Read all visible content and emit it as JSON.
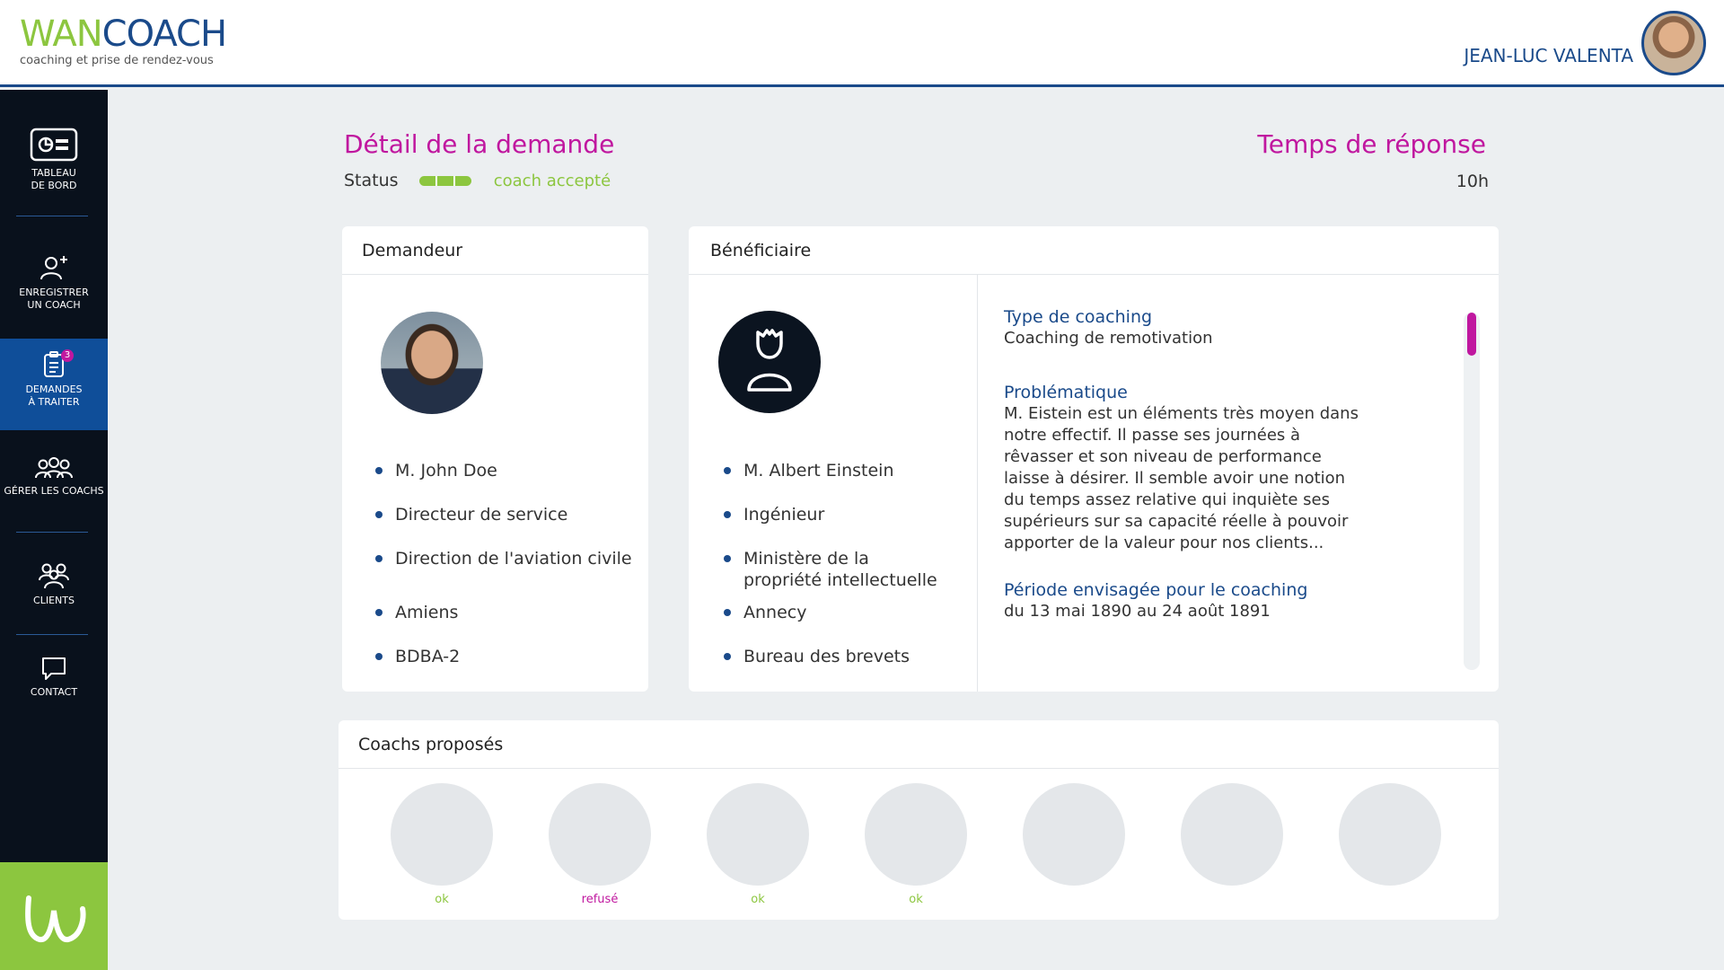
{
  "header": {
    "logo_main_a": "WAN",
    "logo_main_b": "COACH",
    "logo_sub": "coaching et prise de rendez-vous",
    "user_name": "JEAN-LUC VALENTA"
  },
  "sidebar": {
    "items": [
      {
        "label_1": "TABLEAU",
        "label_2": "DE BORD",
        "icon": "dashboard-icon"
      },
      {
        "label_1": "ENREGISTRER",
        "label_2": "UN COACH",
        "icon": "add-user-icon"
      },
      {
        "label_1": "DEMANDES",
        "label_2": "À TRAITER",
        "icon": "requests-icon",
        "badge": "3"
      },
      {
        "label_1": "GÉRER LES COACHS",
        "icon": "manage-coaches-icon"
      },
      {
        "label_1": "CLIENTS",
        "icon": "clients-icon"
      },
      {
        "label_1": "CONTACT",
        "icon": "chat-icon"
      }
    ],
    "brand_icon": "wancoach-w-logo"
  },
  "main": {
    "title": "Détail de la demande",
    "status_label": "Status",
    "status_text": "coach accepté",
    "response_title": "Temps de réponse",
    "response_time": "10h"
  },
  "requester": {
    "header": "Demandeur",
    "items": [
      "M. John Doe",
      "Directeur de service",
      "Direction de l'aviation civile",
      "Amiens",
      "BDBA-2"
    ]
  },
  "beneficiary": {
    "header": "Bénéficiaire",
    "items": [
      "M. Albert Einstein",
      "Ingénieur",
      "Ministère de la propriété intellectuelle",
      "Annecy",
      "Bureau des brevets"
    ],
    "details": [
      {
        "label": "Type de coaching",
        "value": "Coaching de remotivation"
      },
      {
        "label": "Problématique",
        "value": "M. Eistein est un éléments très moyen dans notre effectif. Il passe ses journées à rêvasser et son niveau de performance laisse à désirer. Il semble avoir une notion du temps assez relative qui inquiète ses supérieurs sur sa capacité réelle à pouvoir apporter de la valeur pour nos clients..."
      },
      {
        "label": "Période envisagée pour le coaching",
        "value": "du 13 mai 1890 au 24 août 1891"
      }
    ]
  },
  "coaches": {
    "header": "Coachs proposés",
    "items": [
      {
        "status": "ok"
      },
      {
        "status": "refusé"
      },
      {
        "status": "ok"
      },
      {
        "status": "ok"
      },
      {
        "status": ""
      },
      {
        "status": ""
      },
      {
        "status": ""
      }
    ]
  },
  "colors": {
    "brand_green": "#8cc63f",
    "brand_blue": "#1a4a8a",
    "accent_magenta": "#c0179f",
    "sidebar_bg": "#09111c",
    "sidebar_active": "#0f4e99"
  }
}
